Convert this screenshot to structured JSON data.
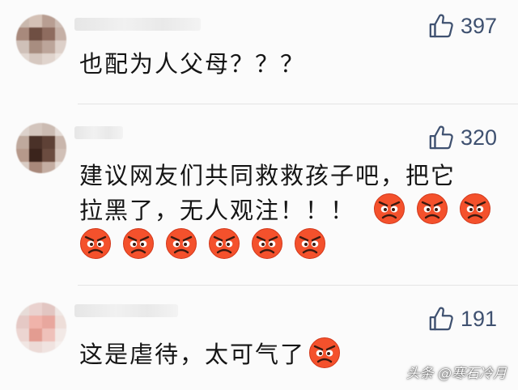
{
  "comments": [
    {
      "text_lines": [
        "也配为人父母？？？"
      ],
      "likes": "397",
      "emoji_count_line1": 0,
      "emoji_count_line2": 0
    },
    {
      "text_lines": [
        "建议网友们共同救救孩子吧，把它",
        "拉黑了，无人观注！！！"
      ],
      "likes": "320",
      "emoji_count_line2": 3,
      "emoji_count_line3": 6
    },
    {
      "text_lines": [
        "这是虐待，太可气了"
      ],
      "likes": "191",
      "emoji_count_line1": 1
    }
  ],
  "icons": {
    "like": "thumbs-up-icon",
    "emoji": "angry-face-emoji"
  },
  "colors": {
    "like_count": "#3f5170",
    "text": "#151515",
    "emoji_face": "#f4512c"
  },
  "watermark": "头条 @寒石冷月"
}
